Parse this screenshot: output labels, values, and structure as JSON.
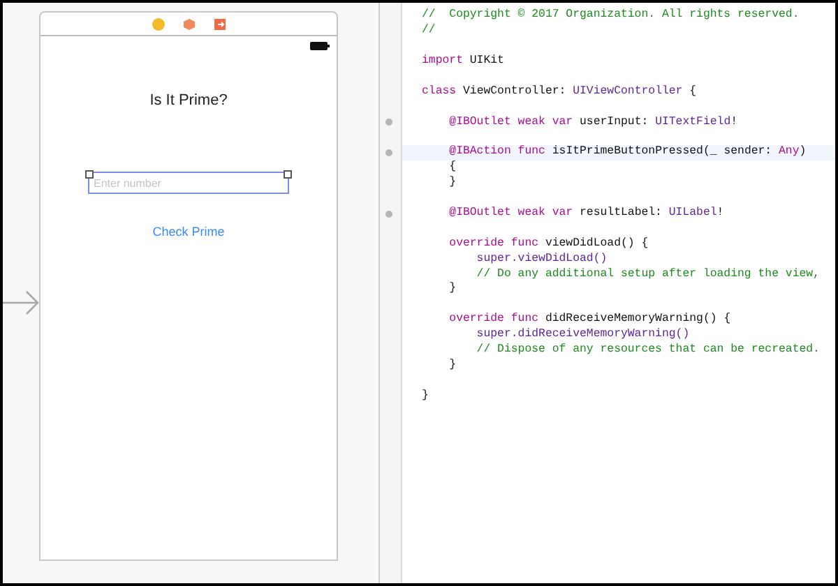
{
  "scene": {
    "title_label": "Is It Prime?",
    "text_field": {
      "placeholder": "Enter number",
      "selected": true
    },
    "button": "Check Prime"
  },
  "code": {
    "lines": [
      {
        "marker": false,
        "highlighted": false,
        "blank_before": false,
        "tokens": [
          {
            "kind": "comment",
            "text": "//  Copyright © 2017 Organization. All rights reserved."
          }
        ]
      },
      {
        "marker": false,
        "highlighted": false,
        "blank_before": false,
        "tokens": [
          {
            "kind": "comment",
            "text": "//"
          }
        ]
      },
      {
        "marker": false,
        "highlighted": false,
        "blank_before": true,
        "tokens": [
          {
            "kind": "keyword",
            "text": "import"
          },
          {
            "kind": "plain",
            "text": " UIKit"
          }
        ]
      },
      {
        "marker": false,
        "highlighted": false,
        "blank_before": true,
        "tokens": [
          {
            "kind": "keyword",
            "text": "class"
          },
          {
            "kind": "plain",
            "text": " ViewController: "
          },
          {
            "kind": "type",
            "text": "UIViewController"
          },
          {
            "kind": "plain",
            "text": " {"
          }
        ]
      },
      {
        "marker": true,
        "highlighted": false,
        "blank_before": true,
        "tokens": [
          {
            "kind": "keyword",
            "text": "    @IBOutlet weak var"
          },
          {
            "kind": "plain",
            "text": " userInput: "
          },
          {
            "kind": "type",
            "text": "UITextField"
          },
          {
            "kind": "plain",
            "text": "!"
          }
        ]
      },
      {
        "marker": true,
        "highlighted": true,
        "blank_before": true,
        "tokens": [
          {
            "kind": "keyword",
            "text": "    @IBAction func"
          },
          {
            "kind": "plain",
            "text": " isItPrimeButtonPressed(_ sender: "
          },
          {
            "kind": "keyword",
            "text": "Any"
          },
          {
            "kind": "plain",
            "text": ")"
          }
        ]
      },
      {
        "marker": false,
        "highlighted": false,
        "blank_before": false,
        "tokens": [
          {
            "kind": "plain",
            "text": "    {"
          }
        ]
      },
      {
        "marker": false,
        "highlighted": false,
        "blank_before": false,
        "tokens": [
          {
            "kind": "plain",
            "text": "    }"
          }
        ]
      },
      {
        "marker": true,
        "highlighted": false,
        "blank_before": true,
        "tokens": [
          {
            "kind": "keyword",
            "text": "    @IBOutlet weak var"
          },
          {
            "kind": "plain",
            "text": " resultLabel: "
          },
          {
            "kind": "type",
            "text": "UILabel"
          },
          {
            "kind": "plain",
            "text": "!"
          }
        ]
      },
      {
        "marker": false,
        "highlighted": false,
        "blank_before": true,
        "tokens": [
          {
            "kind": "keyword",
            "text": "    override func"
          },
          {
            "kind": "plain",
            "text": " viewDidLoad() {"
          }
        ]
      },
      {
        "marker": false,
        "highlighted": false,
        "blank_before": false,
        "tokens": [
          {
            "kind": "type",
            "text": "        super.viewDidLoad()"
          }
        ]
      },
      {
        "marker": false,
        "highlighted": false,
        "blank_before": false,
        "tokens": [
          {
            "kind": "comment",
            "text": "        // Do any additional setup after loading the view,"
          }
        ]
      },
      {
        "marker": false,
        "highlighted": false,
        "blank_before": false,
        "tokens": [
          {
            "kind": "plain",
            "text": "    }"
          }
        ]
      },
      {
        "marker": false,
        "highlighted": false,
        "blank_before": true,
        "tokens": [
          {
            "kind": "keyword",
            "text": "    override func"
          },
          {
            "kind": "plain",
            "text": " didReceiveMemoryWarning() {"
          }
        ]
      },
      {
        "marker": false,
        "highlighted": false,
        "blank_before": false,
        "tokens": [
          {
            "kind": "type",
            "text": "        super.didReceiveMemoryWarning()"
          }
        ]
      },
      {
        "marker": false,
        "highlighted": false,
        "blank_before": false,
        "tokens": [
          {
            "kind": "comment",
            "text": "        // Dispose of any resources that can be recreated."
          }
        ]
      },
      {
        "marker": false,
        "highlighted": false,
        "blank_before": false,
        "tokens": [
          {
            "kind": "plain",
            "text": "    }"
          }
        ]
      },
      {
        "marker": false,
        "highlighted": false,
        "blank_before": true,
        "tokens": [
          {
            "kind": "plain",
            "text": "}"
          }
        ]
      }
    ]
  }
}
